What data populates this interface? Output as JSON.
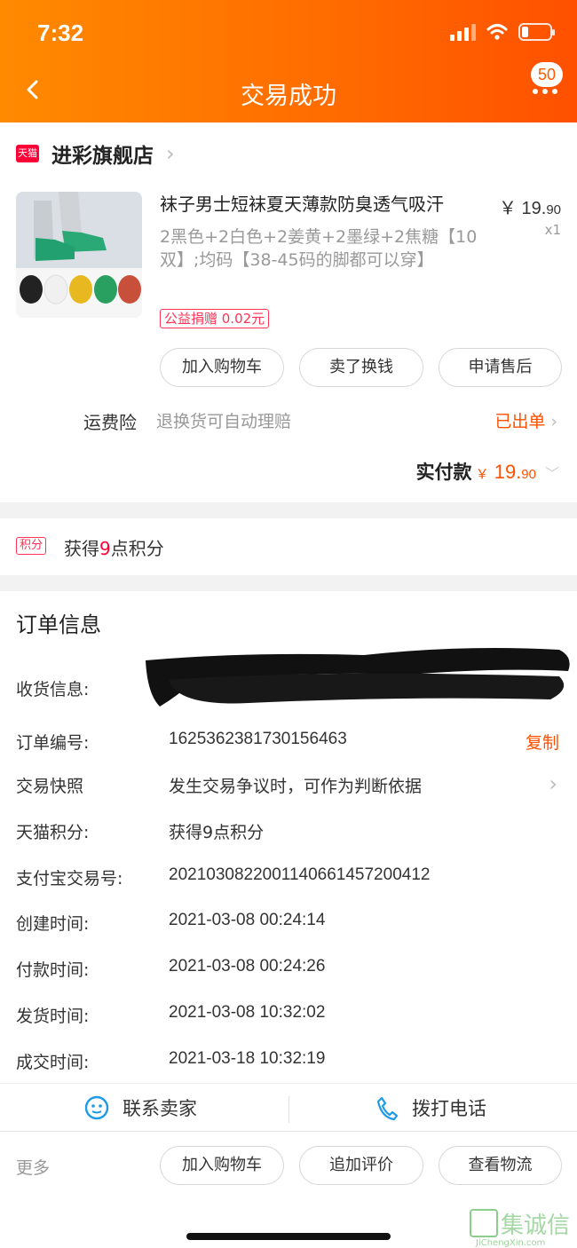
{
  "status": {
    "time": "7:32"
  },
  "nav": {
    "title": "交易成功",
    "badge": "50"
  },
  "store": {
    "platform_tag": "天猫",
    "name": "进彩旗舰店"
  },
  "product": {
    "title": "袜子男士短袜夏天薄款防臭透气吸汗",
    "sku": "2黑色+2白色+2姜黄+2墨绿+2焦糖【10双】;均码【38-45码的脚都可以穿】",
    "currency": "￥",
    "price_int": "19.",
    "price_dec": "90",
    "qty": "x1",
    "charity": "公益捐赠 0.02元"
  },
  "actions": {
    "add_cart": "加入购物车",
    "resell": "卖了换钱",
    "after_sale": "申请售后"
  },
  "insurance": {
    "label": "运费险",
    "desc": "退换货可自动理赔",
    "status": "已出单"
  },
  "payment": {
    "label": "实付款",
    "currency": "￥",
    "amount_int": "19.",
    "amount_dec": "90"
  },
  "points": {
    "tag": "积分",
    "prefix": "获得",
    "value": "9",
    "suffix": "点积分"
  },
  "order_info": {
    "title": "订单信息",
    "receiver_label": "收货信息:",
    "order_no_label": "订单编号:",
    "order_no": "1625362381730156463",
    "copy": "复制",
    "snapshot_label": "交易快照",
    "snapshot": "发生交易争议时，可作为判断依据",
    "tmall_points_label": "天猫积分:",
    "tmall_points": "获得9点积分",
    "alipay_label": "支付宝交易号:",
    "alipay_no": "2021030822001140661457200412",
    "created_label": "创建时间:",
    "created": "2021-03-08 00:24:14",
    "paid_label": "付款时间:",
    "paid": "2021-03-08 00:24:26",
    "shipped_label": "发货时间:",
    "shipped": "2021-03-08 10:32:02",
    "completed_label": "成交时间:",
    "completed": "2021-03-18 10:32:19"
  },
  "contact": {
    "seller": "联系卖家",
    "phone": "拨打电话"
  },
  "bottom": {
    "more": "更多",
    "add_cart": "加入购物车",
    "review": "追加评价",
    "logistics": "查看物流"
  },
  "watermark": {
    "brand": "集诚信",
    "url": "JiChengXin.com"
  }
}
